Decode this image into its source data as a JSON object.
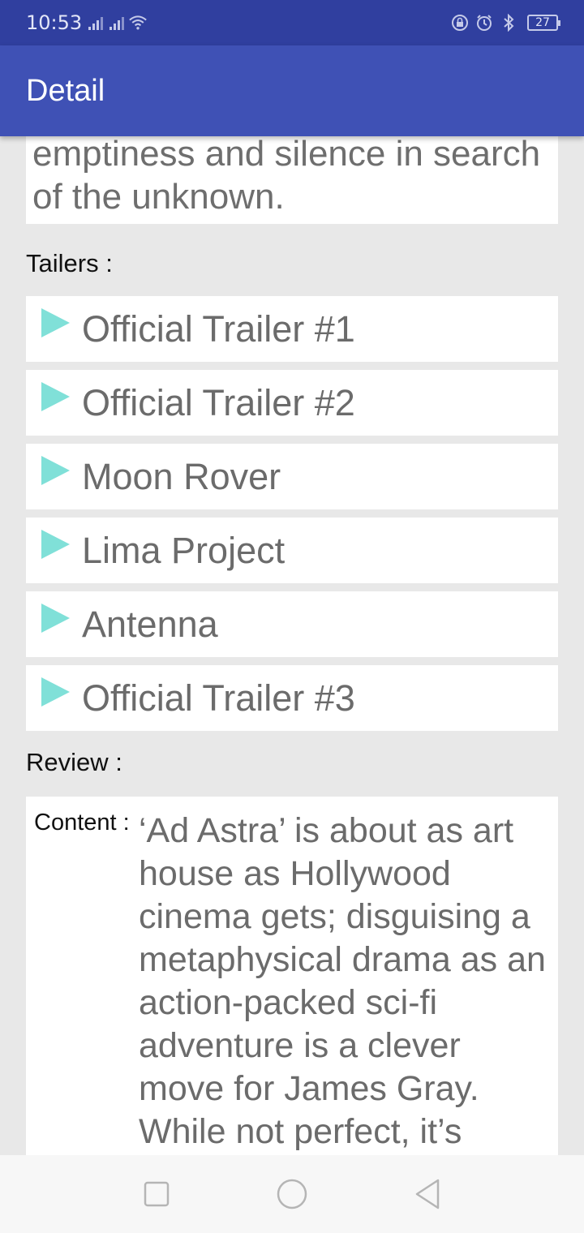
{
  "status_bar": {
    "time": "10:53",
    "battery": "27",
    "icons": [
      "signal-icon",
      "signal-icon",
      "wifi-icon",
      "lock-rotation-icon",
      "alarm-icon",
      "bluetooth-icon",
      "battery-icon"
    ]
  },
  "app_bar": {
    "title": "Detail"
  },
  "overview": {
    "text": "emptiness and silence in search of the unknown."
  },
  "trailers": {
    "label": "Tailers :",
    "items": [
      {
        "name": "Official Trailer #1"
      },
      {
        "name": "Official Trailer #2"
      },
      {
        "name": "Moon Rover"
      },
      {
        "name": "Lima Project"
      },
      {
        "name": "Antenna"
      },
      {
        "name": "Official Trailer #3"
      }
    ]
  },
  "review": {
    "label": "Review :",
    "content_label": "Content :",
    "content": "‘Ad Astra’ is about as art house as Hollywood cinema gets; disguising a metaphysical drama as an action-packed sci-fi adventure is a clever move for James Gray. While not perfect, it’s"
  },
  "nav_bar": {
    "icons": [
      "recent-apps-icon",
      "home-icon",
      "back-icon"
    ]
  },
  "colors": {
    "primary": "#3f51b5",
    "primary_dark": "#303f9f",
    "play_icon": "#80e0d8"
  }
}
